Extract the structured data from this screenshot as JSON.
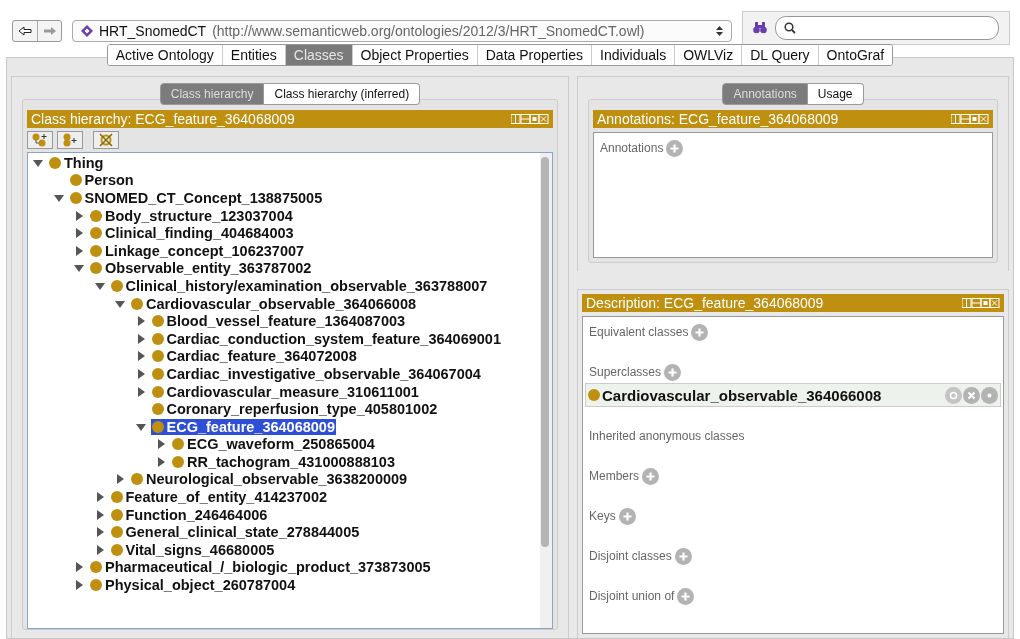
{
  "toolbar": {
    "ontology_name": "HRT_SnomedCT",
    "ontology_iri": "(http://www.semanticweb.org/ontologies/2012/3/HRT_SnomedCT.owl)"
  },
  "tabs": [
    {
      "label": "Active Ontology",
      "selected": false
    },
    {
      "label": "Entities",
      "selected": false
    },
    {
      "label": "Classes",
      "selected": true
    },
    {
      "label": "Object Properties",
      "selected": false
    },
    {
      "label": "Data Properties",
      "selected": false
    },
    {
      "label": "Individuals",
      "selected": false
    },
    {
      "label": "OWLViz",
      "selected": false
    },
    {
      "label": "DL Query",
      "selected": false
    },
    {
      "label": "OntoGraf",
      "selected": false
    }
  ],
  "left": {
    "view_tabs": [
      {
        "label": "Class hierarchy",
        "selected": true
      },
      {
        "label": "Class hierarchy (inferred)",
        "selected": false
      }
    ],
    "title": "Class hierarchy: ECG_feature_364068009",
    "tree": [
      {
        "label": "Thing",
        "kind": "branch",
        "expanded": true,
        "selected": false,
        "children": [
          {
            "label": "Person",
            "kind": "leaf",
            "selected": false
          },
          {
            "label": "SNOMED_CT_Concept_138875005",
            "kind": "branch",
            "expanded": true,
            "selected": false,
            "children": [
              {
                "label": "Body_structure_123037004",
                "kind": "branch",
                "expanded": false,
                "selected": false
              },
              {
                "label": "Clinical_finding_404684003",
                "kind": "branch",
                "expanded": false,
                "selected": false
              },
              {
                "label": "Linkage_concept_106237007",
                "kind": "branch",
                "expanded": false,
                "selected": false
              },
              {
                "label": "Observable_entity_363787002",
                "kind": "branch",
                "expanded": true,
                "selected": false,
                "children": [
                  {
                    "label": "Clinical_history/examination_observable_363788007",
                    "kind": "branch",
                    "expanded": true,
                    "selected": false,
                    "children": [
                      {
                        "label": "Cardiovascular_observable_364066008",
                        "kind": "branch",
                        "expanded": true,
                        "selected": false,
                        "children": [
                          {
                            "label": "Blood_vessel_feature_1364087003",
                            "kind": "branch",
                            "expanded": false,
                            "selected": false
                          },
                          {
                            "label": "Cardiac_conduction_system_feature_364069001",
                            "kind": "branch",
                            "expanded": false,
                            "selected": false
                          },
                          {
                            "label": "Cardiac_feature_364072008",
                            "kind": "branch",
                            "expanded": false,
                            "selected": false
                          },
                          {
                            "label": "Cardiac_investigative_observable_364067004",
                            "kind": "branch",
                            "expanded": false,
                            "selected": false
                          },
                          {
                            "label": "Cardiovascular_measure_310611001",
                            "kind": "branch",
                            "expanded": false,
                            "selected": false
                          },
                          {
                            "label": "Coronary_reperfusion_type_405801002",
                            "kind": "leaf",
                            "selected": false
                          },
                          {
                            "label": "ECG_feature_364068009",
                            "kind": "branch",
                            "expanded": true,
                            "selected": true,
                            "children": [
                              {
                                "label": "ECG_waveform_250865004",
                                "kind": "branch",
                                "expanded": false,
                                "selected": false
                              },
                              {
                                "label": "RR_tachogram_431000888103",
                                "kind": "branch",
                                "expanded": false,
                                "selected": false
                              }
                            ]
                          }
                        ]
                      },
                      {
                        "label": "Neurological_observable_3638200009",
                        "kind": "branch",
                        "expanded": false,
                        "selected": false
                      }
                    ]
                  },
                  {
                    "label": "Feature_of_entity_414237002",
                    "kind": "branch",
                    "expanded": false,
                    "selected": false
                  },
                  {
                    "label": "Function_246464006",
                    "kind": "branch",
                    "expanded": false,
                    "selected": false
                  },
                  {
                    "label": "General_clinical_state_278844005",
                    "kind": "branch",
                    "expanded": false,
                    "selected": false
                  },
                  {
                    "label": "Vital_signs_46680005",
                    "kind": "branch",
                    "expanded": false,
                    "selected": false
                  }
                ]
              },
              {
                "label": "Pharmaceutical_/_biologic_product_373873005",
                "kind": "branch",
                "expanded": false,
                "selected": false
              },
              {
                "label": "Physical_object_260787004",
                "kind": "branch",
                "expanded": false,
                "selected": false
              }
            ]
          }
        ]
      }
    ]
  },
  "right": {
    "view_tabs": [
      {
        "label": "Annotations",
        "selected": true
      },
      {
        "label": "Usage",
        "selected": false
      }
    ],
    "annotations": {
      "title": "Annotations: ECG_feature_364068009",
      "sections": [
        {
          "label": "Annotations",
          "add": true
        }
      ]
    },
    "description": {
      "title": "Description: ECG_feature_364068009",
      "sections": [
        {
          "label": "Equivalent classes",
          "add": true
        },
        {
          "label": "Superclasses",
          "add": true,
          "items": [
            "Cardiovascular_observable_364066008"
          ]
        },
        {
          "label": "Inherited anonymous classes",
          "add": false
        },
        {
          "label": "Members",
          "add": true
        },
        {
          "label": "Keys",
          "add": true
        },
        {
          "label": "Disjoint classes",
          "add": true
        },
        {
          "label": "Disjoint union of",
          "add": true
        }
      ]
    }
  }
}
